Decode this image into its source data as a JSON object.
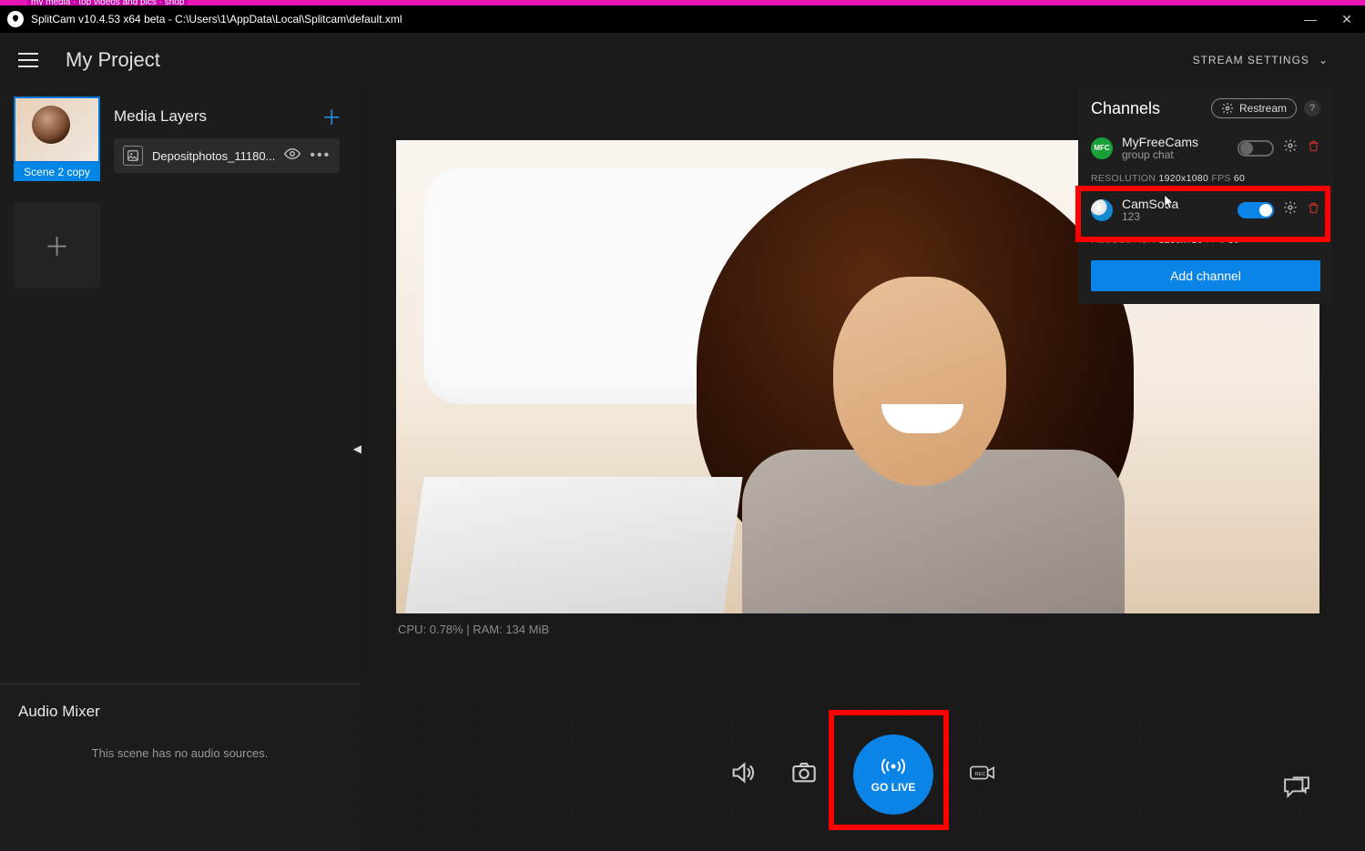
{
  "titlebar": {
    "text": "SplitCam v10.4.53 x64 beta - C:\\Users\\1\\AppData\\Local\\Splitcam\\default.xml"
  },
  "header": {
    "project_title": "My Project",
    "stream_settings": "STREAM SETTINGS"
  },
  "sidebar": {
    "scene_label": "Scene 2 copy",
    "media_layers_title": "Media Layers",
    "layer_name": "Depositphotos_11180...",
    "audio_mixer_title": "Audio Mixer",
    "audio_empty": "This scene has no audio sources."
  },
  "stats": {
    "cpu_label": "CPU:",
    "cpu_value": "0.78%",
    "ram_label": "RAM:",
    "ram_value": "134 MiB"
  },
  "golive": {
    "label": "GO LIVE"
  },
  "channels": {
    "title": "Channels",
    "restream": "Restream",
    "rows": [
      {
        "name": "MyFreeCams",
        "sub": "group chat",
        "res_label": "RESOLUTION",
        "res_val": "1920x1080",
        "fps_label": "FPS",
        "fps_val": "60"
      },
      {
        "name": "CamSoda",
        "sub": "123",
        "res_label": "RESOLUTION",
        "res_val": "1280x720",
        "fps_label": "FPS",
        "fps_val": "30"
      }
    ],
    "add": "Add channel"
  }
}
